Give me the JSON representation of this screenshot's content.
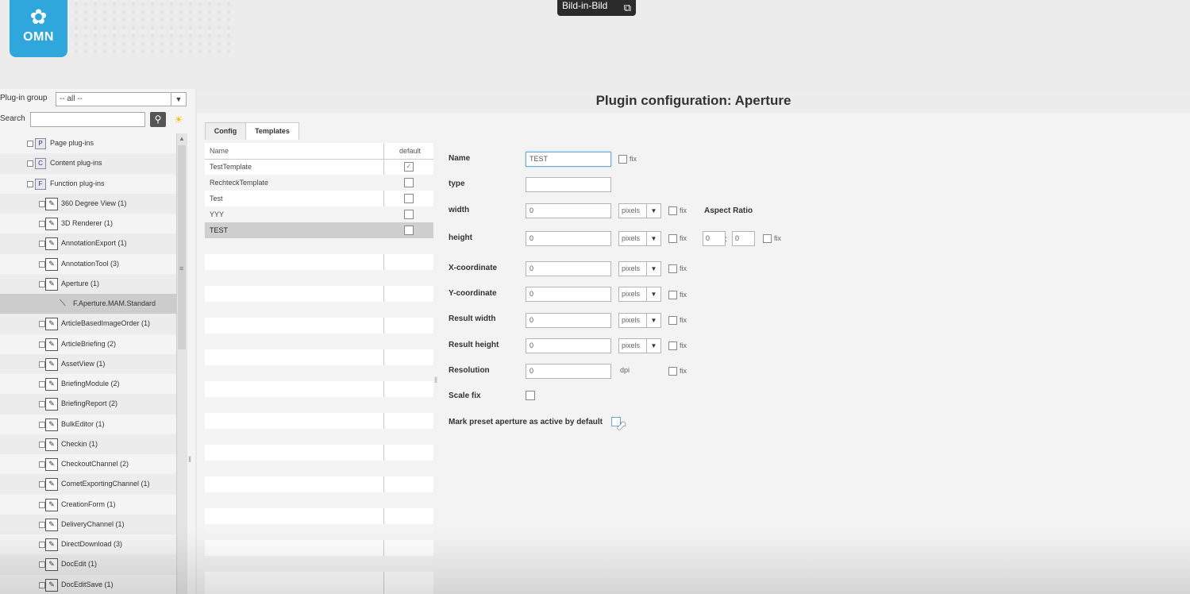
{
  "logo": {
    "text": "OMN"
  },
  "pip": {
    "label": "Bild-in-Bild"
  },
  "sidebar": {
    "group_label": "Plug-in group",
    "group_value": "-- all --",
    "search_label": "Search",
    "search_value": "",
    "tree": [
      {
        "label": "Page plug-ins",
        "kind": "category",
        "icon": "P",
        "level": 0
      },
      {
        "label": "Content plug-ins",
        "kind": "category",
        "icon": "C",
        "level": 0
      },
      {
        "label": "Function plug-ins",
        "kind": "category",
        "icon": "F",
        "level": 0
      },
      {
        "label": "360 Degree View (1)",
        "kind": "plugin",
        "level": 1
      },
      {
        "label": "3D Renderer (1)",
        "kind": "plugin",
        "level": 1
      },
      {
        "label": "AnnotationExport (1)",
        "kind": "plugin",
        "level": 1
      },
      {
        "label": "AnnotationTool (3)",
        "kind": "plugin",
        "level": 1
      },
      {
        "label": "Aperture (1)",
        "kind": "plugin",
        "level": 1
      },
      {
        "label": "F.Aperture.MAM.Standard",
        "kind": "leaf",
        "level": 2,
        "selected": true
      },
      {
        "label": "ArticleBasedImageOrder (1)",
        "kind": "plugin",
        "level": 1
      },
      {
        "label": "ArticleBriefing (2)",
        "kind": "plugin",
        "level": 1
      },
      {
        "label": "AssetView (1)",
        "kind": "plugin",
        "level": 1
      },
      {
        "label": "BriefingModule (2)",
        "kind": "plugin",
        "level": 1
      },
      {
        "label": "BriefingReport (2)",
        "kind": "plugin",
        "level": 1
      },
      {
        "label": "BulkEditor (1)",
        "kind": "plugin",
        "level": 1
      },
      {
        "label": "Checkin (1)",
        "kind": "plugin",
        "level": 1
      },
      {
        "label": "CheckoutChannel (2)",
        "kind": "plugin",
        "level": 1
      },
      {
        "label": "CometExportingChannel (1)",
        "kind": "plugin",
        "level": 1
      },
      {
        "label": "CreationForm (1)",
        "kind": "plugin",
        "level": 1
      },
      {
        "label": "DeliveryChannel (1)",
        "kind": "plugin",
        "level": 1
      },
      {
        "label": "DirectDownload (3)",
        "kind": "plugin",
        "level": 1
      },
      {
        "label": "DocEdit (1)",
        "kind": "plugin",
        "level": 1
      },
      {
        "label": "DocEditSave (1)",
        "kind": "plugin",
        "level": 1
      }
    ]
  },
  "main": {
    "title": "Plugin configuration: Aperture",
    "tabs": [
      {
        "label": "Config"
      },
      {
        "label": "Templates"
      }
    ],
    "grid": {
      "col_name": "Name",
      "col_default": "default",
      "rows": [
        {
          "name": "TestTemplate",
          "default": true
        },
        {
          "name": "RechteckTemplate",
          "default": false
        },
        {
          "name": "Test",
          "default": false
        },
        {
          "name": "YYY",
          "default": false
        },
        {
          "name": "TEST",
          "default": false,
          "selected": true
        }
      ]
    },
    "form": {
      "name_label": "Name",
      "name_value": "TEST",
      "type_label": "type",
      "type_value": "",
      "width_label": "width",
      "width_value": "0",
      "width_unit": "pixels",
      "height_label": "height",
      "height_value": "0",
      "height_unit": "pixels",
      "x_label": "X-coordinate",
      "x_value": "0",
      "x_unit": "pixels",
      "y_label": "Y-coordinate",
      "y_value": "0",
      "y_unit": "pixels",
      "rw_label": "Result width",
      "rw_value": "0",
      "rw_unit": "pixels",
      "rh_label": "Result height",
      "rh_value": "0",
      "rh_unit": "pixels",
      "res_label": "Resolution",
      "res_value": "0",
      "res_unit": "dpi",
      "scale_label": "Scale fix",
      "mark_label": "Mark preset aperture as active by default",
      "fix_label": "fix",
      "ar_label": "Aspect Ratio",
      "ar_w": "0",
      "ar_h": "0",
      "ar_sep": ":"
    }
  }
}
